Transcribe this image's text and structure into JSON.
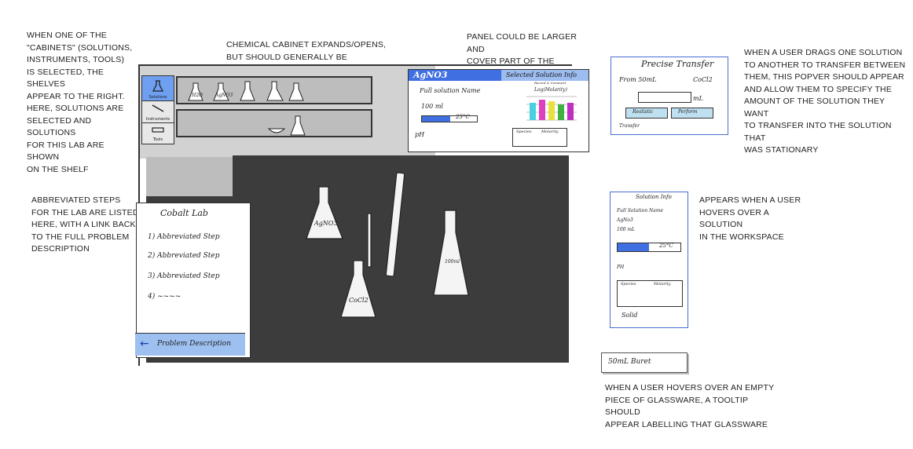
{
  "annotations": {
    "cabinets_note": "When one of the\n\"cabinets\" (solutions,\ninstruments, tools)\nis selected, the shelves\nappear to the right.\nHere, solutions are\nselected and solutions\nfor this lab are shown\non the shelf",
    "cabinet_expand_note": "Chemical cabinet expands/opens,\nbut should generally be minimized",
    "panel_note": "Panel could be larger and\ncover part of the counter",
    "popover_note": "When a user drags one solution\nto another to transfer between\nthem, this popver should appear\nand allow them to specify the\namount of the solution they want\nto transfer into the solution that\nwas stationary",
    "steps_note": "Abbreviated steps\nfor the lab are listed\nhere, with a link back\nto the full problem\ndescription",
    "hover_note": "Appears when a user\nhovers over a solution\nin the workspace",
    "tooltip_note": "When a user hovers over an empty\npiece of glassware, a tooltip should\nappear labelling that glassware"
  },
  "cabinet_tabs": [
    "Solutions",
    "Instruments",
    "Tools"
  ],
  "shelf_items": [
    "H2O",
    "AgNO3"
  ],
  "info_panel": {
    "title": "AgNO3",
    "header_right": "Selected Solution Info",
    "name": "Full solution Name",
    "volume": "100 ml",
    "temp": "25°C",
    "ph": "pH",
    "chart_label": "Log(Molarity)",
    "chart_legend": "Record & Comment",
    "col1": "Species",
    "col2": "Molarity"
  },
  "workspace": {
    "flask1": "AgNO3",
    "flask2": "CoCl2",
    "flask3": "100ml"
  },
  "steps_panel": {
    "title": "Cobalt Lab",
    "steps": [
      "1) Abbreviated Step",
      "2) Abbreviated Step",
      "3) Abbreviated Step",
      "4) ~~~~"
    ],
    "link": "Problem Description"
  },
  "transfer_popover": {
    "title": "Precise Transfer",
    "from": "From 50mL",
    "to": "CoCl2",
    "unit": "mL",
    "realistic": "Realistic",
    "perform": "Perform",
    "footer": "Transfer"
  },
  "solution_popover": {
    "title": "Solution Info",
    "name": "Full Solution Name",
    "formula": "AgNo3",
    "volume": "100 mL",
    "temp": "25°C",
    "ph": "PH",
    "col1": "Species",
    "col2": "Molarity",
    "state": "Solid"
  },
  "tooltip": {
    "label": "50mL Buret"
  }
}
